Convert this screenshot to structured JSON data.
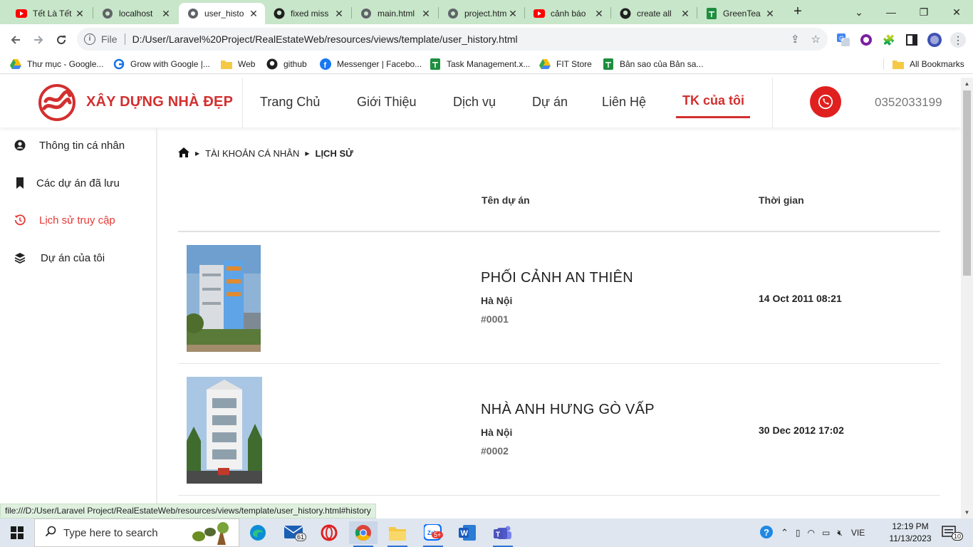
{
  "browser": {
    "tabs": [
      {
        "title": "Tết Là Tết",
        "icon": "youtube-icon"
      },
      {
        "title": "localhost",
        "icon": "globe-icon"
      },
      {
        "title": "user_histo",
        "icon": "globe-icon",
        "active": true
      },
      {
        "title": "fixed miss",
        "icon": "github-icon"
      },
      {
        "title": "main.html",
        "icon": "globe-icon"
      },
      {
        "title": "project.htm",
        "icon": "globe-icon"
      },
      {
        "title": "cảnh báo",
        "icon": "youtube-icon"
      },
      {
        "title": "create all",
        "icon": "github-icon"
      },
      {
        "title": "GreenTea",
        "icon": "sheets-icon"
      }
    ],
    "address": {
      "scheme": "File",
      "url": "D:/User/Laravel%20Project/RealEstateWeb/resources/views/template/user_history.html"
    },
    "bookmarks": [
      {
        "label": "Thư mục - Google...",
        "icon": "drive-icon"
      },
      {
        "label": "Grow with Google |...",
        "icon": "google-icon"
      },
      {
        "label": "Web",
        "icon": "folder-icon"
      },
      {
        "label": "github",
        "icon": "github-icon"
      },
      {
        "label": "Messenger | Facebo...",
        "icon": "facebook-icon"
      },
      {
        "label": "Task Management.x...",
        "icon": "sheets-icon"
      },
      {
        "label": "FIT Store",
        "icon": "drive-icon"
      },
      {
        "label": "Bản sao của Bản sa...",
        "icon": "sheets-icon"
      }
    ],
    "all_bookmarks": "All Bookmarks",
    "status_url": "file:///D:/User/Laravel Project/RealEstateWeb/resources/views/template/user_history.html#history"
  },
  "site": {
    "brand": "XÂY DỰNG NHÀ ĐẸP",
    "nav": [
      "Trang Chủ",
      "Giới Thiệu",
      "Dịch vụ",
      "Dự án",
      "Liên Hệ",
      "TK của tôi"
    ],
    "phone": "0352033199",
    "sidebar": [
      {
        "label": "Thông tin cá nhân",
        "icon": "user-circle-icon"
      },
      {
        "label": "Các dự án đã lưu",
        "icon": "bookmark-icon"
      },
      {
        "label": "Lịch sử truy cập",
        "icon": "history-icon",
        "active": true
      },
      {
        "label": "Dự án của tôi",
        "icon": "layers-icon"
      }
    ],
    "breadcrumb": [
      "TÀI KHOẢN CÁ NHÂN",
      "LỊCH SỬ"
    ],
    "table": {
      "headers": {
        "name": "Tên dự án",
        "time": "Thời gian"
      },
      "rows": [
        {
          "name": "PHỐI CẢNH AN THIÊN",
          "city": "Hà Nội",
          "code": "#0001",
          "time": "14 Oct 2011 08:21"
        },
        {
          "name": "NHÀ ANH HƯNG GÒ VẤP",
          "city": "Hà Nội",
          "code": "#0002",
          "time": "30 Dec 2012 17:02"
        }
      ]
    },
    "accent": "#d32f2f"
  },
  "taskbar": {
    "search_placeholder": "Type here to search",
    "mail_badge": "61",
    "zalo_badge": "5+",
    "lang": "VIE",
    "time": "12:19 PM",
    "date": "11/13/2023",
    "notifications": "10"
  }
}
